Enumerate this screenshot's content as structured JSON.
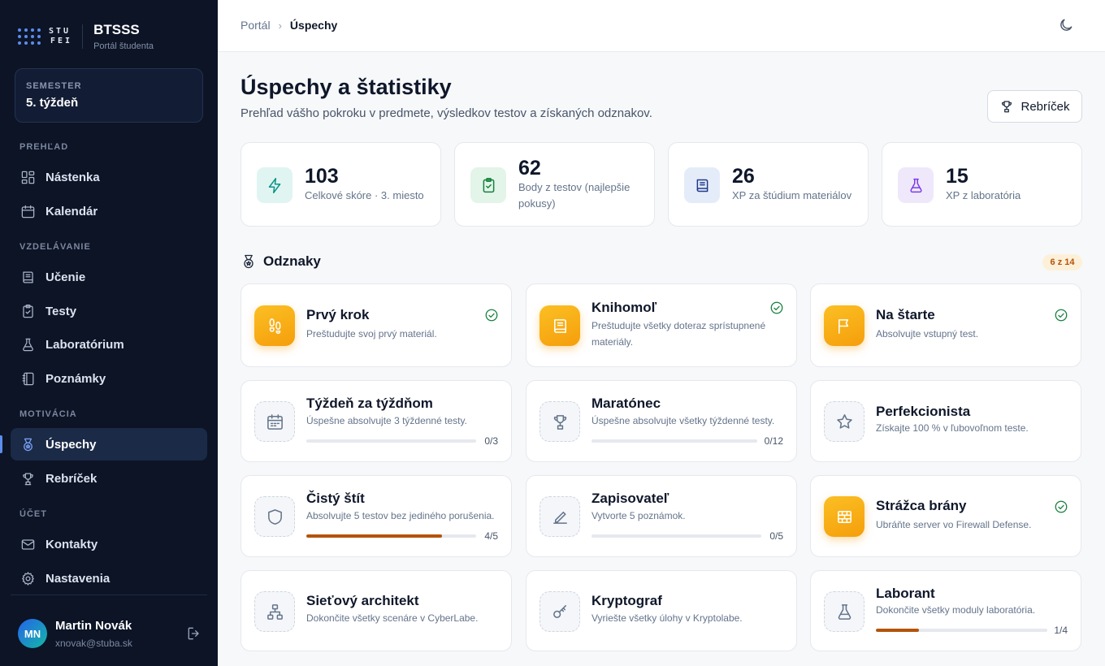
{
  "brand": {
    "mark": "STU FEI",
    "mark_line1": "STU",
    "mark_line2": "FEI",
    "title": "BTSSS",
    "subtitle": "Portál študenta"
  },
  "semester": {
    "label": "SEMESTER",
    "value": "5. týždeň"
  },
  "nav": {
    "sections": [
      "PREHĽAD",
      "VZDELÁVANIE",
      "MOTIVÁCIA",
      "ÚČET"
    ],
    "items": [
      {
        "label": "Nástenka",
        "icon": "dashboard-icon"
      },
      {
        "label": "Kalendár",
        "icon": "calendar-icon"
      },
      {
        "label": "Učenie",
        "icon": "book-icon"
      },
      {
        "label": "Testy",
        "icon": "clipboard-check-icon"
      },
      {
        "label": "Laboratórium",
        "icon": "flask-icon"
      },
      {
        "label": "Poznámky",
        "icon": "notebook-icon"
      },
      {
        "label": "Úspechy",
        "icon": "medal-icon",
        "active": true
      },
      {
        "label": "Rebríček",
        "icon": "trophy-icon"
      },
      {
        "label": "Kontakty",
        "icon": "mail-icon"
      },
      {
        "label": "Nastavenia",
        "icon": "gear-icon"
      }
    ]
  },
  "user": {
    "initials": "MN",
    "name": "Martin Novák",
    "email": "xnovak@stuba.sk"
  },
  "breadcrumb": {
    "home": "Portál",
    "current": "Úspechy"
  },
  "header": {
    "title": "Úspechy a štatistiky",
    "subtitle": "Prehľad vášho pokroku v predmete, výsledkov testov a získaných odznakov.",
    "leaderboard_button": "Rebríček"
  },
  "stats": [
    {
      "value": "103",
      "label": "Celkové skóre · 3. miesto",
      "icon": "bolt-icon",
      "color": "#0d9488"
    },
    {
      "value": "62",
      "label": "Body z testov (najlepšie pokusy)",
      "icon": "clipboard-check-icon",
      "color": "#15803d"
    },
    {
      "value": "26",
      "label": "XP za štúdium materiálov",
      "icon": "book-icon",
      "color": "#1e3a8a"
    },
    {
      "value": "15",
      "label": "XP z laboratória",
      "icon": "flask-icon",
      "color": "#7c3aed"
    }
  ],
  "badges_section": {
    "title": "Odznaky",
    "count": "6 z 14"
  },
  "badges": [
    {
      "title": "Prvý krok",
      "desc": "Preštudujte svoj prvý materiál.",
      "icon": "footsteps-icon",
      "earned": true
    },
    {
      "title": "Knihomoľ",
      "desc": "Preštudujte všetky doteraz sprístupnené materiály.",
      "icon": "book-icon",
      "earned": true
    },
    {
      "title": "Na štarte",
      "desc": "Absolvujte vstupný test.",
      "icon": "flag-icon",
      "earned": true
    },
    {
      "title": "Týždeň za týždňom",
      "desc": "Úspešne absolvujte 3 týždenné testy.",
      "icon": "calendar-icon",
      "earned": false,
      "progress": "0/3",
      "fraction": 0
    },
    {
      "title": "Maratónec",
      "desc": "Úspešne absolvujte všetky týždenné testy.",
      "icon": "trophy-icon",
      "earned": false,
      "progress": "0/12",
      "fraction": 0
    },
    {
      "title": "Perfekcionista",
      "desc": "Získajte 100 % v ľubovoľnom teste.",
      "icon": "star-icon",
      "earned": false
    },
    {
      "title": "Čistý štít",
      "desc": "Absolvujte 5 testov bez jediného porušenia.",
      "icon": "shield-icon",
      "earned": false,
      "progress": "4/5",
      "fraction": 0.8
    },
    {
      "title": "Zapisovateľ",
      "desc": "Vytvorte 5 poznámok.",
      "icon": "pencil-icon",
      "earned": false,
      "progress": "0/5",
      "fraction": 0
    },
    {
      "title": "Strážca brány",
      "desc": "Ubráňte server vo Firewall Defense.",
      "icon": "firewall-icon",
      "earned": true
    },
    {
      "title": "Sieťový architekt",
      "desc": "Dokončite všetky scenáre v CyberLabe.",
      "icon": "network-icon",
      "earned": false
    },
    {
      "title": "Kryptograf",
      "desc": "Vyriešte všetky úlohy v Kryptolabe.",
      "icon": "key-icon",
      "earned": false
    },
    {
      "title": "Laborant",
      "desc": "Dokončite všetky moduly laboratória.",
      "icon": "flask-icon",
      "earned": false,
      "progress": "1/4",
      "fraction": 0.25
    }
  ]
}
